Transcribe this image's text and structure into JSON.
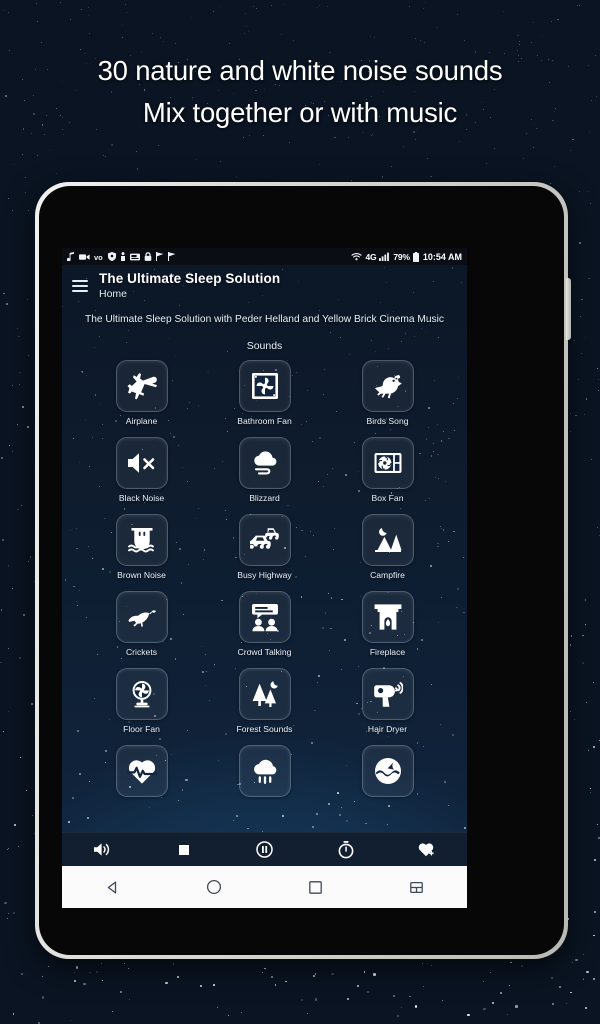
{
  "promo": {
    "headline_line1": "30 nature and white noise sounds",
    "headline_line2": "Mix together or with music"
  },
  "colors": {
    "backdrop_top": "#05080e",
    "backdrop_bottom": "#1b5580",
    "device_bezel": "#d9d9d6",
    "screen_bg": "#0e1d30",
    "player_bar": "#121f30",
    "nav_bar": "#fbfbfb",
    "text_primary": "#ffffff"
  },
  "device": {
    "side_button": "power-button"
  },
  "statusbar": {
    "left_icons": [
      "music-note-icon",
      "camcorder-icon",
      "volte-icon",
      "shield-icon",
      "person-icon",
      "sd-card-icon",
      "lock-icon",
      "flag-icon",
      "flag-icon"
    ],
    "wifi_icon": "wifi-icon",
    "network_label": "4G",
    "signal_icon": "signal-bars-icon",
    "battery_percent": "79%",
    "battery_icon": "battery-icon",
    "time": "10:54 AM"
  },
  "appbar": {
    "menu_icon": "hamburger-menu-icon",
    "title": "The Ultimate Sleep Solution",
    "subtitle": "Home"
  },
  "content": {
    "description": "The Ultimate Sleep Solution with Peder Helland and Yellow Brick Cinema Music",
    "section_header": "Sounds"
  },
  "sounds": [
    {
      "label": "Airplane",
      "icon": "airplane-icon"
    },
    {
      "label": "Bathroom Fan",
      "icon": "bathroom-fan-icon"
    },
    {
      "label": "Birds Song",
      "icon": "bird-icon"
    },
    {
      "label": "Black Noise",
      "icon": "speaker-mute-icon"
    },
    {
      "label": "Blizzard",
      "icon": "cloud-wind-icon"
    },
    {
      "label": "Box Fan",
      "icon": "box-fan-icon"
    },
    {
      "label": "Brown Noise",
      "icon": "waterfall-icon"
    },
    {
      "label": "Busy Highway",
      "icon": "cars-icon"
    },
    {
      "label": "Campfire",
      "icon": "campfire-moon-icon"
    },
    {
      "label": "Crickets",
      "icon": "cricket-icon"
    },
    {
      "label": "Crowd Talking",
      "icon": "crowd-talking-icon"
    },
    {
      "label": "Fireplace",
      "icon": "fireplace-icon"
    },
    {
      "label": "Floor Fan",
      "icon": "floor-fan-icon"
    },
    {
      "label": "Forest Sounds",
      "icon": "forest-trees-moon-icon"
    },
    {
      "label": "Hair Dryer",
      "icon": "hair-dryer-icon"
    },
    {
      "label": "",
      "icon": "heartbeat-icon"
    },
    {
      "label": "",
      "icon": "rain-cloud-icon"
    },
    {
      "label": "",
      "icon": "ocean-wave-icon"
    }
  ],
  "player_controls": [
    {
      "name": "volume-button",
      "icon": "volume-icon"
    },
    {
      "name": "stop-button",
      "icon": "stop-icon"
    },
    {
      "name": "pause-button",
      "icon": "pause-circle-icon"
    },
    {
      "name": "timer-button",
      "icon": "timer-icon"
    },
    {
      "name": "favorites-button",
      "icon": "heart-icon"
    }
  ],
  "navbar": [
    {
      "name": "back-button",
      "icon": "back-triangle-icon"
    },
    {
      "name": "home-button",
      "icon": "home-circle-icon"
    },
    {
      "name": "recents-button",
      "icon": "recents-square-icon"
    },
    {
      "name": "split-screen-button",
      "icon": "split-screen-icon"
    }
  ]
}
